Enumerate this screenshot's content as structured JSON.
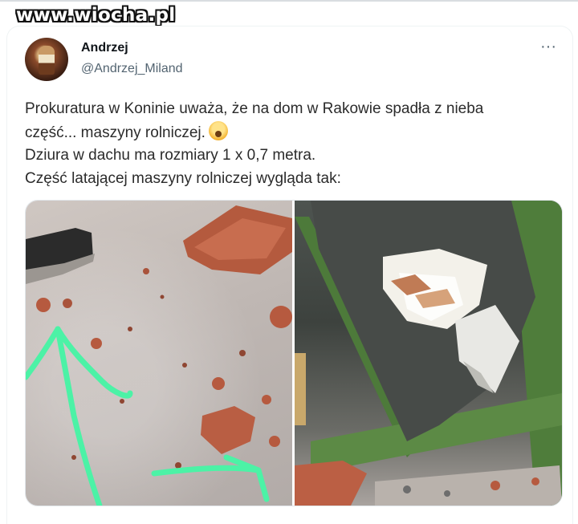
{
  "watermark": "www.wiocha.pl",
  "tweet": {
    "author_name": "Andrzej",
    "author_handle": "@Andrzej_Miland",
    "more_label": "···",
    "lines": [
      "Prokuratura w Koninie uważa, że na dom w Rakowie spadła z nieba",
      "część... maszyny rolniczej.",
      "Dziura w dachu ma rozmiary 1 x 0,7 metra.",
      "Część latającej maszyny rolniczej wygląda tak:"
    ],
    "emoji": "screaming-face-emoji"
  },
  "media": {
    "photos": [
      {
        "name": "roof-tile-debris-photo"
      },
      {
        "name": "roof-hole-photo"
      }
    ],
    "colors": {
      "arrow": "#4cf2a6",
      "tile": "#b65a3f",
      "beam": "#4d7a3a",
      "concrete": "#c4bdb9"
    }
  }
}
